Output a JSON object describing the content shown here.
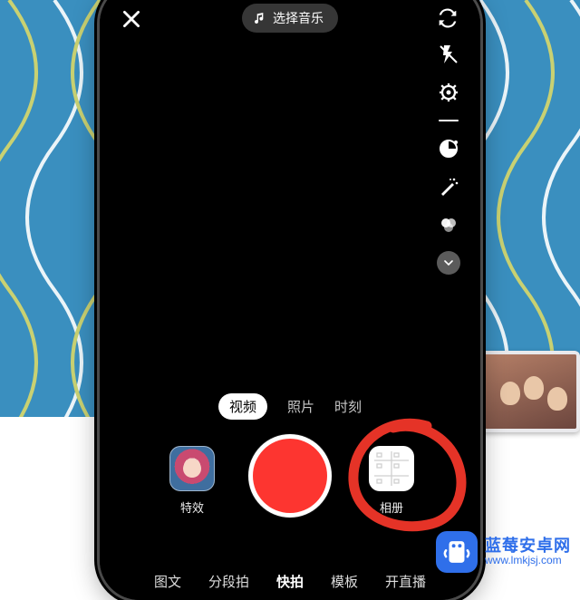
{
  "top": {
    "select_music": "选择音乐"
  },
  "rail_icons": [
    "flash",
    "settings",
    "divider",
    "timer",
    "beautify",
    "filters",
    "more"
  ],
  "modes": {
    "video": "视频",
    "photo": "照片",
    "moment": "时刻",
    "active": "video"
  },
  "controls": {
    "effects_label": "特效",
    "album_label": "相册"
  },
  "tabs": {
    "items": [
      "图文",
      "分段拍",
      "快拍",
      "模板",
      "开直播"
    ],
    "active_index": 2
  },
  "watermark": {
    "title": "蓝莓安卓网",
    "url": "www.lmkjsj.com"
  }
}
